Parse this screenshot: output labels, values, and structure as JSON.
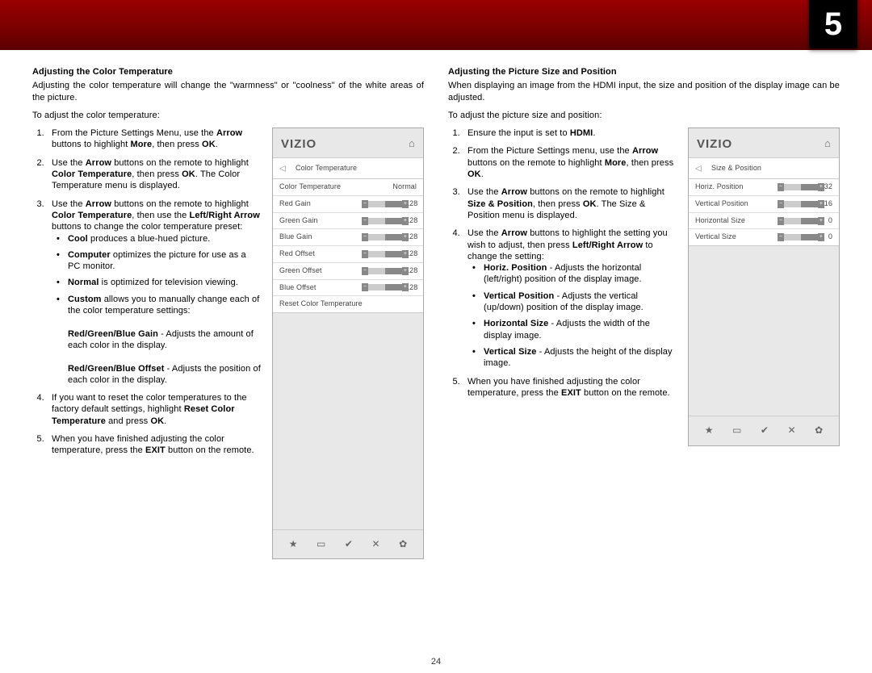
{
  "chapter": "5",
  "page_number": "24",
  "left": {
    "title": "Adjusting the Color Temperature",
    "intro": "Adjusting the color temperature will change the \"warmness\" or \"coolness\" of the white areas of the picture.",
    "lead": "To adjust the color temperature:",
    "menu": {
      "brand": "VIZIO",
      "subtitle": "Color Temperature",
      "first_row_label": "Color Temperature",
      "first_row_value": "Normal",
      "rows": [
        {
          "label": "Red Gain",
          "value": "128"
        },
        {
          "label": "Green Gain",
          "value": "128"
        },
        {
          "label": "Blue Gain",
          "value": "128"
        },
        {
          "label": "Red Offset",
          "value": "128"
        },
        {
          "label": "Green Offset",
          "value": "128"
        },
        {
          "label": "Blue Offset",
          "value": "128"
        }
      ],
      "reset": "Reset Color Temperature"
    }
  },
  "right": {
    "title": "Adjusting the Picture Size and Position",
    "intro": "When displaying an image from the HDMI input, the size and position of the display image can be adjusted.",
    "lead": "To adjust the picture size and position:",
    "menu": {
      "brand": "VIZIO",
      "subtitle": "Size & Position",
      "rows": [
        {
          "label": "Horiz. Position",
          "value": "32"
        },
        {
          "label": "Vertical Position",
          "value": "16"
        },
        {
          "label": "Horizontal Size",
          "value": "0"
        },
        {
          "label": "Vertical Size",
          "value": "0"
        }
      ]
    }
  }
}
